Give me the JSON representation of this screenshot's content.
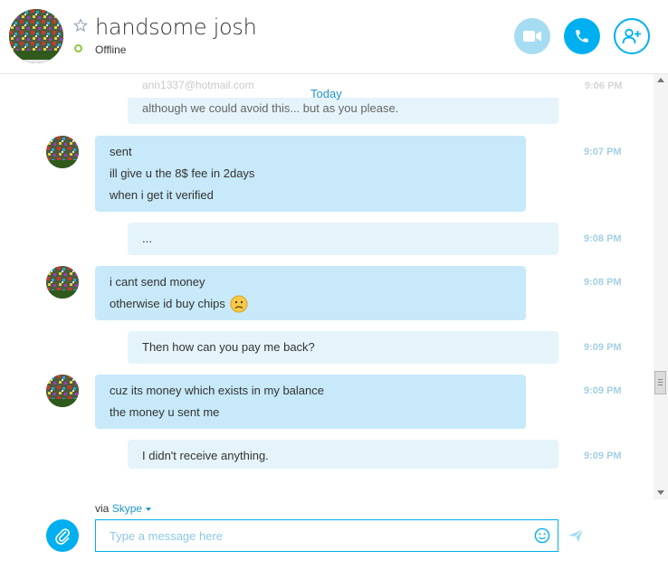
{
  "header": {
    "contact_name": "handsome josh",
    "status": "Offline"
  },
  "conversation": {
    "faded_top_email": "ann1337@hotmail.com",
    "faded_top_time": "9:06 PM",
    "date_divider": "Today",
    "partial_message": "although we could avoid this... but as you please.",
    "messages": [
      {
        "direction": "in",
        "lines": [
          "sent",
          "ill give u the 8$ fee in 2days",
          "when i get it verified"
        ],
        "time": "9:07 PM"
      },
      {
        "direction": "out",
        "lines": [
          "..."
        ],
        "time": "9:08 PM"
      },
      {
        "direction": "in",
        "lines": [
          "i cant send money",
          "otherwise id buy chips"
        ],
        "time": "9:08 PM",
        "emoji": "worried-smiley"
      },
      {
        "direction": "out",
        "lines": [
          "Then how can you pay me back?"
        ],
        "time": "9:09 PM"
      },
      {
        "direction": "in",
        "lines": [
          "cuz its money which exists in my balance",
          "the money u sent me"
        ],
        "time": "9:09 PM"
      },
      {
        "direction": "out",
        "lines": [
          "I didn't receive anything."
        ],
        "time": "9:09 PM"
      }
    ]
  },
  "composer": {
    "via_label": "via",
    "via_service": "Skype",
    "placeholder": "Type a message here",
    "value": ""
  },
  "icons": {
    "video": "video-camera-icon",
    "call": "phone-icon",
    "add_people": "add-person-icon",
    "attach": "paperclip-icon",
    "emoticon": "smiley-icon",
    "send": "send-arrow-icon",
    "favorite": "star-icon"
  },
  "colors": {
    "accent": "#00aff0",
    "link": "#1f94c9",
    "incoming_bubble": "#c7e9f9",
    "outgoing_bubble": "#e5f4fb",
    "presence_offline": "#8cc63f"
  }
}
